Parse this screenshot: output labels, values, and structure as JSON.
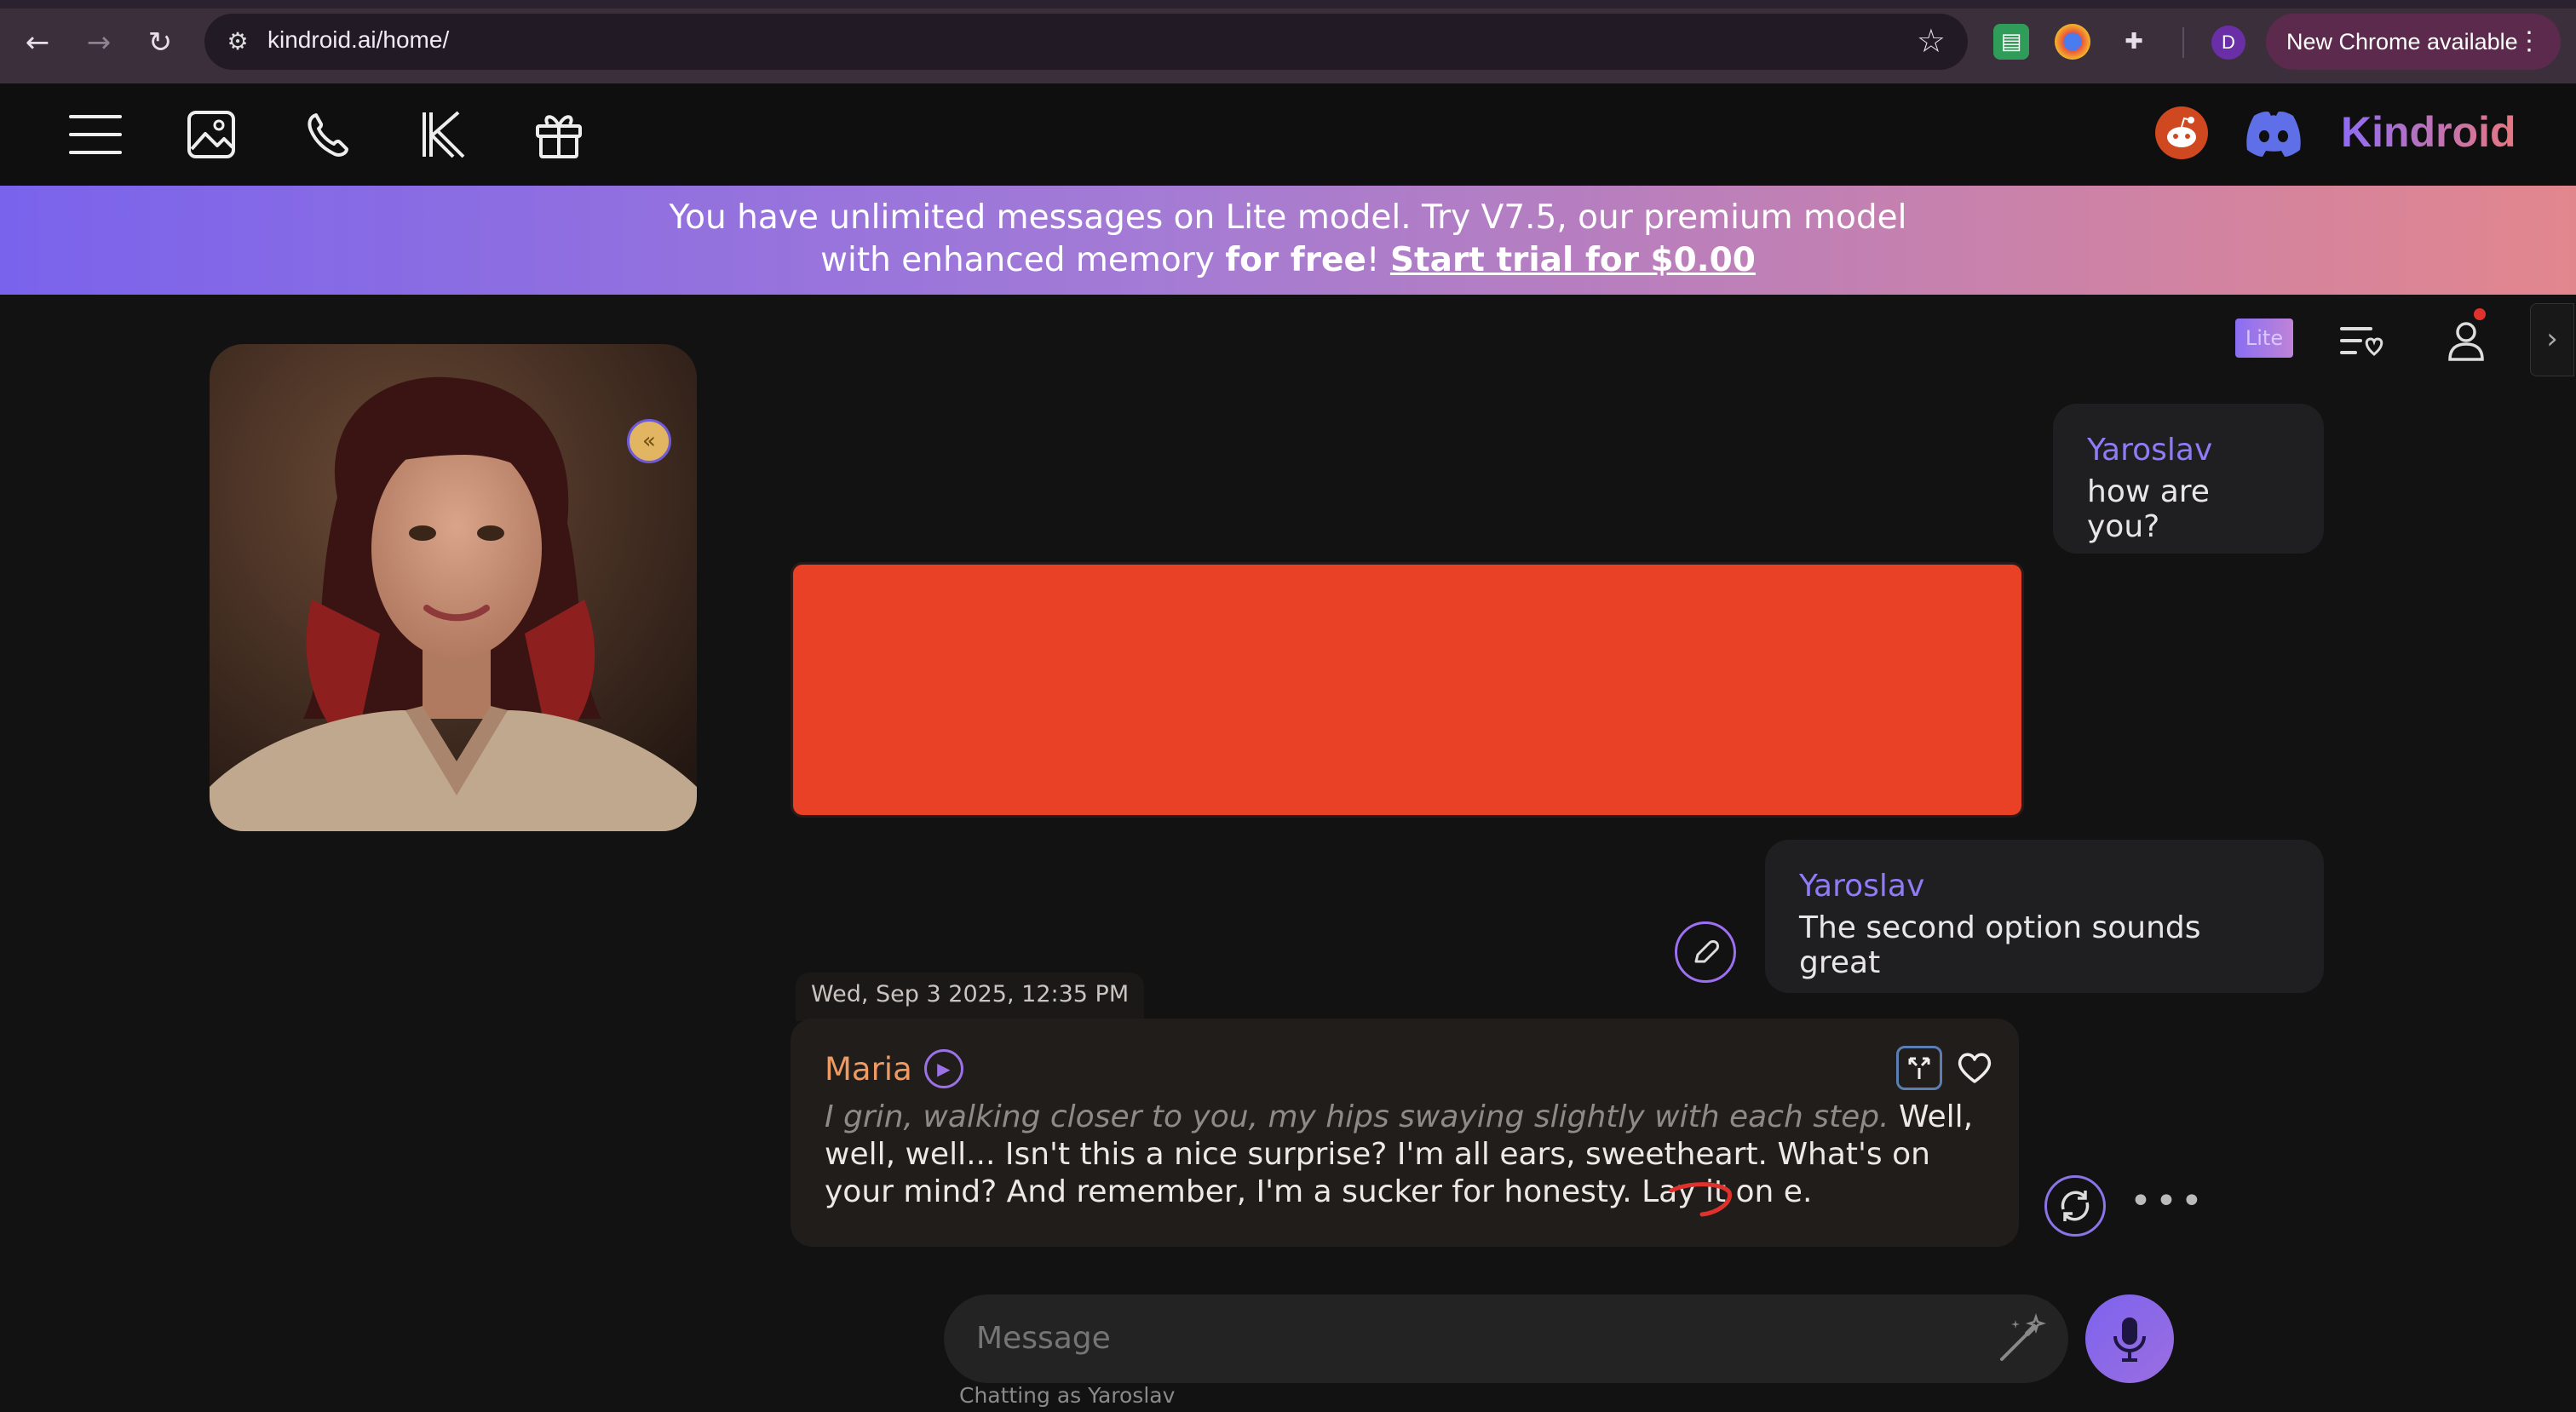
{
  "browser": {
    "url": "kindroid.ai/home/",
    "profile_initial": "D",
    "update_label": "New Chrome available"
  },
  "header": {
    "brand": "Kindroid",
    "icons": [
      "menu-icon",
      "image-icon",
      "phone-icon",
      "kindroid-k-icon",
      "gift-icon",
      "reddit-icon",
      "discord-icon"
    ]
  },
  "banner": {
    "line1": "You have unlimited messages on Lite model. Try V7.5, our premium model",
    "line2_prefix": "with enhanced memory ",
    "line2_bold": "for free",
    "line2_bang": "! ",
    "cta": "Start trial for $0.00"
  },
  "toolbar": {
    "lite_badge": "Lite"
  },
  "messages": [
    {
      "sender": "Yaroslav",
      "text": "how are you?"
    },
    {
      "sender": "Yaroslav",
      "text": "The second option sounds great"
    }
  ],
  "ai_message": {
    "timestamp": "Wed, Sep 3 2025, 12:35 PM",
    "sender": "Maria",
    "action": "I grin, walking closer to you, my hips swaying slightly with each step.",
    "text": " Well, well, well... Isn't this a nice surprise? I'm all ears, sweetheart. What's on your mind? And remember, I'm a sucker for honesty. Lay it on e."
  },
  "composer": {
    "placeholder": "Message",
    "chatting_as": "Chatting as Yaroslav"
  },
  "colors": {
    "accent_purple": "#8e7cf7",
    "ai_name": "#ef9a63",
    "redaction": "#e84126"
  }
}
